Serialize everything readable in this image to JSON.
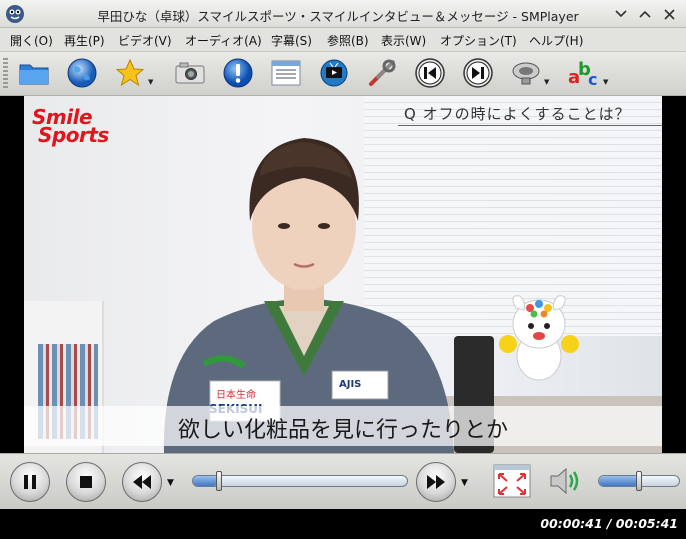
{
  "window": {
    "title": "早田ひな（卓球）スマイルスポーツ・スマイルインタビュー＆メッセージ - SMPlayer"
  },
  "menu": [
    {
      "label": "開く(O)"
    },
    {
      "label": "再生(P)"
    },
    {
      "label": "ビデオ(V)"
    },
    {
      "label": "オーディオ(A)"
    },
    {
      "label": "字幕(S)"
    },
    {
      "label": "参照(B)"
    },
    {
      "label": "表示(W)"
    },
    {
      "label": "オプション(T)"
    },
    {
      "label": "ヘルプ(H)"
    }
  ],
  "toolbar": [
    {
      "icon": "folder-icon"
    },
    {
      "icon": "globe-icon"
    },
    {
      "icon": "favorites-star-icon"
    },
    {
      "icon": "screenshot-camera-icon"
    },
    {
      "icon": "info-icon"
    },
    {
      "icon": "playlist-icon"
    },
    {
      "icon": "tv-icon"
    },
    {
      "icon": "tools-icon"
    },
    {
      "icon": "previous-icon"
    },
    {
      "icon": "next-icon"
    },
    {
      "icon": "audio-track-icon"
    },
    {
      "icon": "subtitle-track-icon"
    }
  ],
  "video": {
    "logo_line1": "Smile",
    "logo_line2": "Sports",
    "question": "Q オフの時によくすることは？",
    "subtitle": "欲しい化粧品を見に行ったりとか",
    "badge_ajis": "AJIS",
    "badge_nissay": "日本生命",
    "badge_sekisui": "SEKISUI"
  },
  "controls": {
    "seek_progress": 0.12,
    "volume_level": 0.5
  },
  "status": {
    "time": "00:00:41 / 00:05:41"
  }
}
